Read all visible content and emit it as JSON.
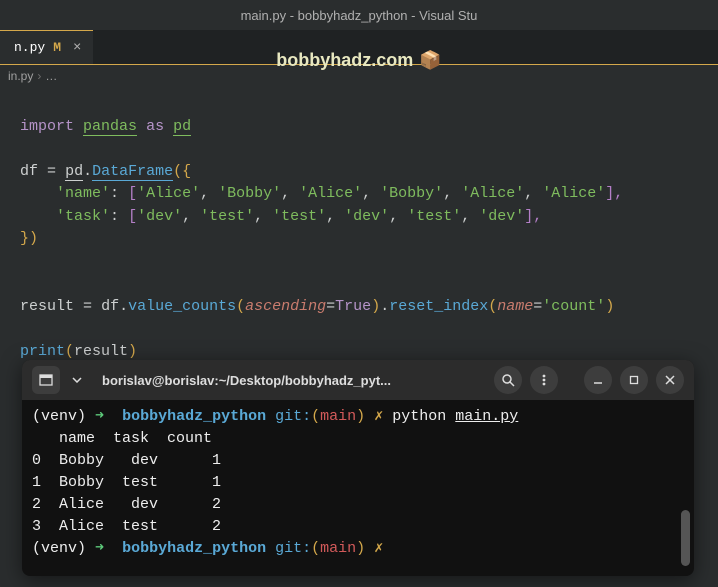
{
  "titlebar": "main.py - bobbyhadz_python - Visual Stu",
  "tab": {
    "name": "n.py",
    "modifier": "M",
    "close": "×"
  },
  "watermark": {
    "text": "bobbyhadz.com",
    "icon": "📦"
  },
  "breadcrumbs": {
    "file": "in.py",
    "sep": "›",
    "rest": "…"
  },
  "code": {
    "l1": {
      "import": "import",
      "pandas": "pandas",
      "as": "as",
      "alias": "pd"
    },
    "l3": {
      "df": "df",
      "eq": "=",
      "pd": "pd",
      "dot": ".",
      "DataFrame": "DataFrame",
      "open": "({"
    },
    "l4": {
      "key": "'name'",
      "colon": ":",
      "open": "[",
      "v1": "'Alice'",
      "v2": "'Bobby'",
      "v3": "'Alice'",
      "v4": "'Bobby'",
      "v5": "'Alice'",
      "v6": "'Alice'",
      "close": "],"
    },
    "l5": {
      "key": "'task'",
      "colon": ":",
      "open": "[",
      "v1": "'dev'",
      "v2": "'test'",
      "v3": "'test'",
      "v4": "'dev'",
      "v5": "'test'",
      "v6": "'dev'",
      "close": "],"
    },
    "l6": {
      "close": "})"
    },
    "l9a": {
      "result": "result",
      "eq": "=",
      "df": "df",
      "dot": ".",
      "vc": "value_counts",
      "open": "(",
      "asc": "ascending",
      "aeq": "=",
      "true": "True",
      "close": ")"
    },
    "l9b": {
      "dot": ".",
      "ri": "reset_index",
      "open": "(",
      "name": "name",
      "neq": "=",
      "count": "'count'",
      "close": ")"
    },
    "l11": {
      "print": "print",
      "open": "(",
      "result": "result",
      "close": ")"
    }
  },
  "terminal": {
    "title": "borislav@borislav:~/Desktop/bobbyhadz_pyt...",
    "prompt": {
      "venv": "(venv)",
      "arrow": "➜",
      "proj": "bobbyhadz_python",
      "git": "git:",
      "lp": "(",
      "branch": "main",
      "rp": ")",
      "bolt": "✗"
    },
    "cmd1": {
      "python": "python",
      "file": "main.py"
    },
    "output": {
      "hdr": "   name  task  count",
      "r0": "0  Bobby   dev      1",
      "r1": "1  Bobby  test      1",
      "r2": "2  Alice   dev      2",
      "r3": "3  Alice  test      2"
    }
  }
}
